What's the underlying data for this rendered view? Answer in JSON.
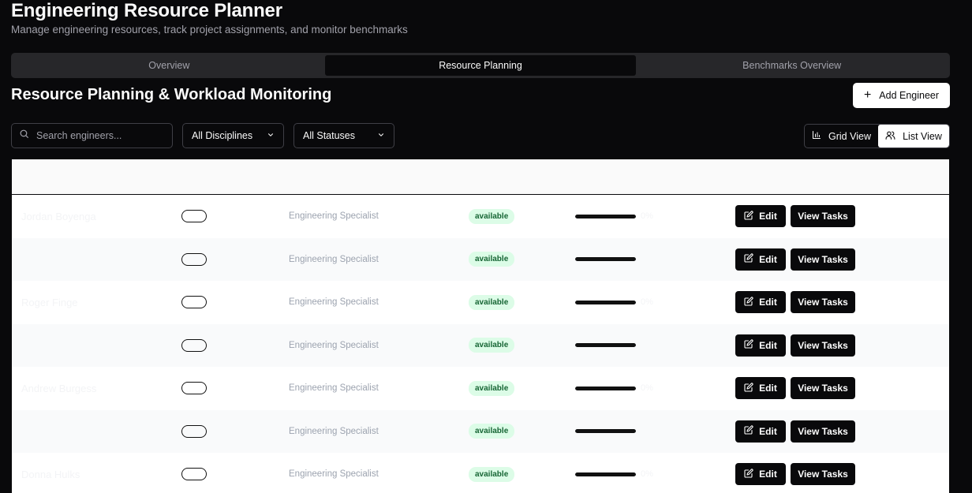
{
  "header": {
    "title": "Engineering Resource Planner",
    "subtitle": "Manage engineering resources, track project assignments, and monitor benchmarks"
  },
  "tabs": [
    {
      "label": "Overview",
      "active": false
    },
    {
      "label": "Resource Planning",
      "active": true
    },
    {
      "label": "Benchmarks Overview",
      "active": false
    }
  ],
  "section": {
    "title": "Resource Planning & Workload Monitoring",
    "add_label": "Add Engineer"
  },
  "filters": {
    "search_placeholder": "Search engineers...",
    "discipline": "All Disciplines",
    "status": "All Statuses"
  },
  "view": {
    "grid_label": "Grid View",
    "list_label": "List View",
    "selected": "List View"
  },
  "table": {
    "edit_label": "Edit",
    "tasks_label": "View Tasks",
    "rows": [
      {
        "name": "Jordan Boyenga",
        "title": "Engineering Specialist",
        "status": "available",
        "utilization_pct": "0%",
        "utilization": 1.0
      },
      {
        "name": "",
        "title": "Engineering Specialist",
        "status": "available",
        "utilization_pct": "",
        "utilization": 1.0
      },
      {
        "name": "Roger Finge",
        "title": "Engineering Specialist",
        "status": "available",
        "utilization_pct": "0%",
        "utilization": 1.0
      },
      {
        "name": "",
        "title": "Engineering Specialist",
        "status": "available",
        "utilization_pct": "",
        "utilization": 1.0
      },
      {
        "name": "Andrew Burgess",
        "title": "Engineering Specialist",
        "status": "available",
        "utilization_pct": "0%",
        "utilization": 1.0
      },
      {
        "name": "",
        "title": "Engineering Specialist",
        "status": "available",
        "utilization_pct": "",
        "utilization": 1.0
      },
      {
        "name": "Donna Hulks",
        "title": "Engineering Specialist",
        "status": "available",
        "utilization_pct": "0%",
        "utilization": 1.0
      }
    ]
  },
  "colors": {
    "background": "#09090b",
    "status_badge_bg": "#dcfce7",
    "status_badge_text": "#166534"
  }
}
